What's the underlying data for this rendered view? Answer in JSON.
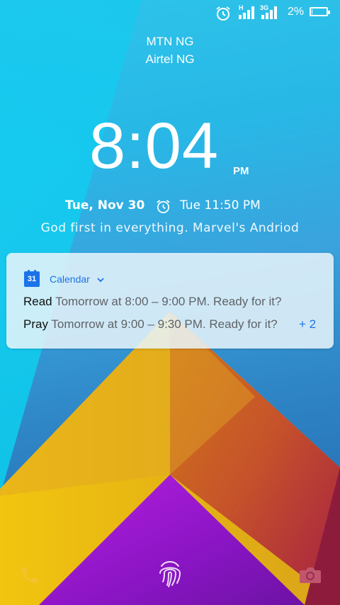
{
  "status_bar": {
    "icons": [
      "alarm-icon",
      "signal-h-icon",
      "signal-3g-icon",
      "battery-icon"
    ],
    "signal1_tag": "H",
    "signal2_tag": "3G",
    "battery_percent": "2%",
    "battery_level": 0.02
  },
  "carriers": [
    "MTN NG",
    "Airtel NG"
  ],
  "clock": {
    "time": "8:04",
    "ampm": "PM"
  },
  "date": "Tue, Nov 30",
  "next_alarm": "Tue 11:50 PM",
  "owner_info": "God first in everything. Marvel's Andriod",
  "notification": {
    "app_icon_text": "31",
    "app_name": "Calendar",
    "accent_color": "#1a73e8",
    "rows": [
      {
        "title": "Read",
        "detail": "Tomorrow at 8:00 – 9:00 PM. Ready for it?"
      },
      {
        "title": "Pray",
        "detail": "Tomorrow at 9:00 – 9:30 PM. Ready for it?"
      }
    ],
    "more_count": "+ 2"
  },
  "shortcuts": [
    "phone-icon",
    "fingerprint-icon",
    "camera-icon"
  ],
  "colors": {
    "phone": "#f2c230",
    "camera": "#c0566e"
  }
}
